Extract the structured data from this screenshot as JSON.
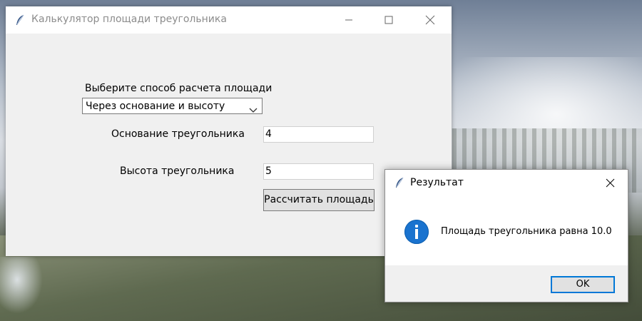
{
  "main_window": {
    "title": "Калькулятор площади треугольника",
    "method_label": "Выберите способ расчета площади",
    "method_selected": "Через основание и высоту",
    "base_label": "Основание треугольника",
    "base_value": "4",
    "height_label": "Высота треугольника",
    "height_value": "5",
    "calculate_button": "Рассчитать площадь"
  },
  "dialog": {
    "title": "Результат",
    "message": "Площадь треугольника равна 10.0",
    "ok_button": "OK"
  },
  "icons": {
    "app_icon": "feather-icon",
    "info_icon": "info-icon",
    "accent_color": "#0078d7",
    "info_color": "#1a73cf"
  }
}
